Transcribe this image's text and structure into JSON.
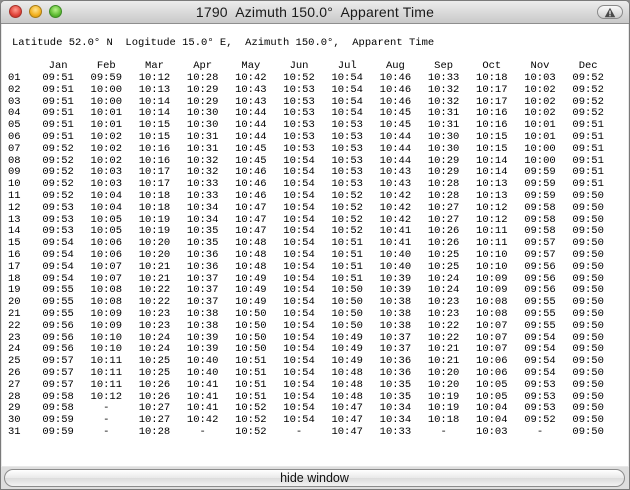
{
  "window": {
    "title": "1790  Azimuth 150.0°  Apparent Time"
  },
  "content": {
    "header_line": "Latitude 52.0° N  Logitude 15.0° E,  Azimuth 150.0°,  Apparent Time",
    "months": [
      "Jan",
      "Feb",
      "Mar",
      "Apr",
      "May",
      "Jun",
      "Jul",
      "Aug",
      "Sep",
      "Oct",
      "Nov",
      "Dec"
    ],
    "rows": [
      {
        "day": "01",
        "times": [
          "09:51",
          "09:59",
          "10:12",
          "10:28",
          "10:42",
          "10:52",
          "10:54",
          "10:46",
          "10:33",
          "10:18",
          "10:03",
          "09:52"
        ]
      },
      {
        "day": "02",
        "times": [
          "09:51",
          "10:00",
          "10:13",
          "10:29",
          "10:43",
          "10:53",
          "10:54",
          "10:46",
          "10:32",
          "10:17",
          "10:02",
          "09:52"
        ]
      },
      {
        "day": "03",
        "times": [
          "09:51",
          "10:00",
          "10:14",
          "10:29",
          "10:43",
          "10:53",
          "10:54",
          "10:46",
          "10:32",
          "10:17",
          "10:02",
          "09:52"
        ]
      },
      {
        "day": "04",
        "times": [
          "09:51",
          "10:01",
          "10:14",
          "10:30",
          "10:44",
          "10:53",
          "10:54",
          "10:45",
          "10:31",
          "10:16",
          "10:02",
          "09:52"
        ]
      },
      {
        "day": "05",
        "times": [
          "09:51",
          "10:01",
          "10:15",
          "10:30",
          "10:44",
          "10:53",
          "10:53",
          "10:45",
          "10:31",
          "10:16",
          "10:01",
          "09:51"
        ]
      },
      {
        "day": "06",
        "times": [
          "09:51",
          "10:02",
          "10:15",
          "10:31",
          "10:44",
          "10:53",
          "10:53",
          "10:44",
          "10:30",
          "10:15",
          "10:01",
          "09:51"
        ]
      },
      {
        "day": "07",
        "times": [
          "09:52",
          "10:02",
          "10:16",
          "10:31",
          "10:45",
          "10:53",
          "10:53",
          "10:44",
          "10:30",
          "10:15",
          "10:00",
          "09:51"
        ]
      },
      {
        "day": "08",
        "times": [
          "09:52",
          "10:02",
          "10:16",
          "10:32",
          "10:45",
          "10:54",
          "10:53",
          "10:44",
          "10:29",
          "10:14",
          "10:00",
          "09:51"
        ]
      },
      {
        "day": "09",
        "times": [
          "09:52",
          "10:03",
          "10:17",
          "10:32",
          "10:46",
          "10:54",
          "10:53",
          "10:43",
          "10:29",
          "10:14",
          "09:59",
          "09:51"
        ]
      },
      {
        "day": "10",
        "times": [
          "09:52",
          "10:03",
          "10:17",
          "10:33",
          "10:46",
          "10:54",
          "10:53",
          "10:43",
          "10:28",
          "10:13",
          "09:59",
          "09:51"
        ]
      },
      {
        "day": "11",
        "times": [
          "09:52",
          "10:04",
          "10:18",
          "10:33",
          "10:46",
          "10:54",
          "10:52",
          "10:42",
          "10:28",
          "10:13",
          "09:59",
          "09:50"
        ]
      },
      {
        "day": "12",
        "times": [
          "09:53",
          "10:04",
          "10:18",
          "10:34",
          "10:47",
          "10:54",
          "10:52",
          "10:42",
          "10:27",
          "10:12",
          "09:58",
          "09:50"
        ]
      },
      {
        "day": "13",
        "times": [
          "09:53",
          "10:05",
          "10:19",
          "10:34",
          "10:47",
          "10:54",
          "10:52",
          "10:42",
          "10:27",
          "10:12",
          "09:58",
          "09:50"
        ]
      },
      {
        "day": "14",
        "times": [
          "09:53",
          "10:05",
          "10:19",
          "10:35",
          "10:47",
          "10:54",
          "10:52",
          "10:41",
          "10:26",
          "10:11",
          "09:58",
          "09:50"
        ]
      },
      {
        "day": "15",
        "times": [
          "09:54",
          "10:06",
          "10:20",
          "10:35",
          "10:48",
          "10:54",
          "10:51",
          "10:41",
          "10:26",
          "10:11",
          "09:57",
          "09:50"
        ]
      },
      {
        "day": "16",
        "times": [
          "09:54",
          "10:06",
          "10:20",
          "10:36",
          "10:48",
          "10:54",
          "10:51",
          "10:40",
          "10:25",
          "10:10",
          "09:57",
          "09:50"
        ]
      },
      {
        "day": "17",
        "times": [
          "09:54",
          "10:07",
          "10:21",
          "10:36",
          "10:48",
          "10:54",
          "10:51",
          "10:40",
          "10:25",
          "10:10",
          "09:56",
          "09:50"
        ]
      },
      {
        "day": "18",
        "times": [
          "09:54",
          "10:07",
          "10:21",
          "10:37",
          "10:49",
          "10:54",
          "10:51",
          "10:39",
          "10:24",
          "10:09",
          "09:56",
          "09:50"
        ]
      },
      {
        "day": "19",
        "times": [
          "09:55",
          "10:08",
          "10:22",
          "10:37",
          "10:49",
          "10:54",
          "10:50",
          "10:39",
          "10:24",
          "10:09",
          "09:56",
          "09:50"
        ]
      },
      {
        "day": "20",
        "times": [
          "09:55",
          "10:08",
          "10:22",
          "10:37",
          "10:49",
          "10:54",
          "10:50",
          "10:38",
          "10:23",
          "10:08",
          "09:55",
          "09:50"
        ]
      },
      {
        "day": "21",
        "times": [
          "09:55",
          "10:09",
          "10:23",
          "10:38",
          "10:50",
          "10:54",
          "10:50",
          "10:38",
          "10:23",
          "10:08",
          "09:55",
          "09:50"
        ]
      },
      {
        "day": "22",
        "times": [
          "09:56",
          "10:09",
          "10:23",
          "10:38",
          "10:50",
          "10:54",
          "10:50",
          "10:38",
          "10:22",
          "10:07",
          "09:55",
          "09:50"
        ]
      },
      {
        "day": "23",
        "times": [
          "09:56",
          "10:10",
          "10:24",
          "10:39",
          "10:50",
          "10:54",
          "10:49",
          "10:37",
          "10:22",
          "10:07",
          "09:54",
          "09:50"
        ]
      },
      {
        "day": "24",
        "times": [
          "09:56",
          "10:10",
          "10:24",
          "10:39",
          "10:50",
          "10:54",
          "10:49",
          "10:37",
          "10:21",
          "10:07",
          "09:54",
          "09:50"
        ]
      },
      {
        "day": "25",
        "times": [
          "09:57",
          "10:11",
          "10:25",
          "10:40",
          "10:51",
          "10:54",
          "10:49",
          "10:36",
          "10:21",
          "10:06",
          "09:54",
          "09:50"
        ]
      },
      {
        "day": "26",
        "times": [
          "09:57",
          "10:11",
          "10:25",
          "10:40",
          "10:51",
          "10:54",
          "10:48",
          "10:36",
          "10:20",
          "10:06",
          "09:54",
          "09:50"
        ]
      },
      {
        "day": "27",
        "times": [
          "09:57",
          "10:11",
          "10:26",
          "10:41",
          "10:51",
          "10:54",
          "10:48",
          "10:35",
          "10:20",
          "10:05",
          "09:53",
          "09:50"
        ]
      },
      {
        "day": "28",
        "times": [
          "09:58",
          "10:12",
          "10:26",
          "10:41",
          "10:51",
          "10:54",
          "10:48",
          "10:35",
          "10:19",
          "10:05",
          "09:53",
          "09:50"
        ]
      },
      {
        "day": "29",
        "times": [
          "09:58",
          "-",
          "10:27",
          "10:41",
          "10:52",
          "10:54",
          "10:47",
          "10:34",
          "10:19",
          "10:04",
          "09:53",
          "09:50"
        ]
      },
      {
        "day": "30",
        "times": [
          "09:59",
          "-",
          "10:27",
          "10:42",
          "10:52",
          "10:54",
          "10:47",
          "10:34",
          "10:18",
          "10:04",
          "09:52",
          "09:50"
        ]
      },
      {
        "day": "31",
        "times": [
          "09:59",
          "-",
          "10:28",
          "-",
          "10:52",
          "-",
          "10:47",
          "10:33",
          "-",
          "10:03",
          "-",
          "09:50"
        ]
      }
    ]
  },
  "footer": {
    "hide_button_label": "hide window"
  }
}
